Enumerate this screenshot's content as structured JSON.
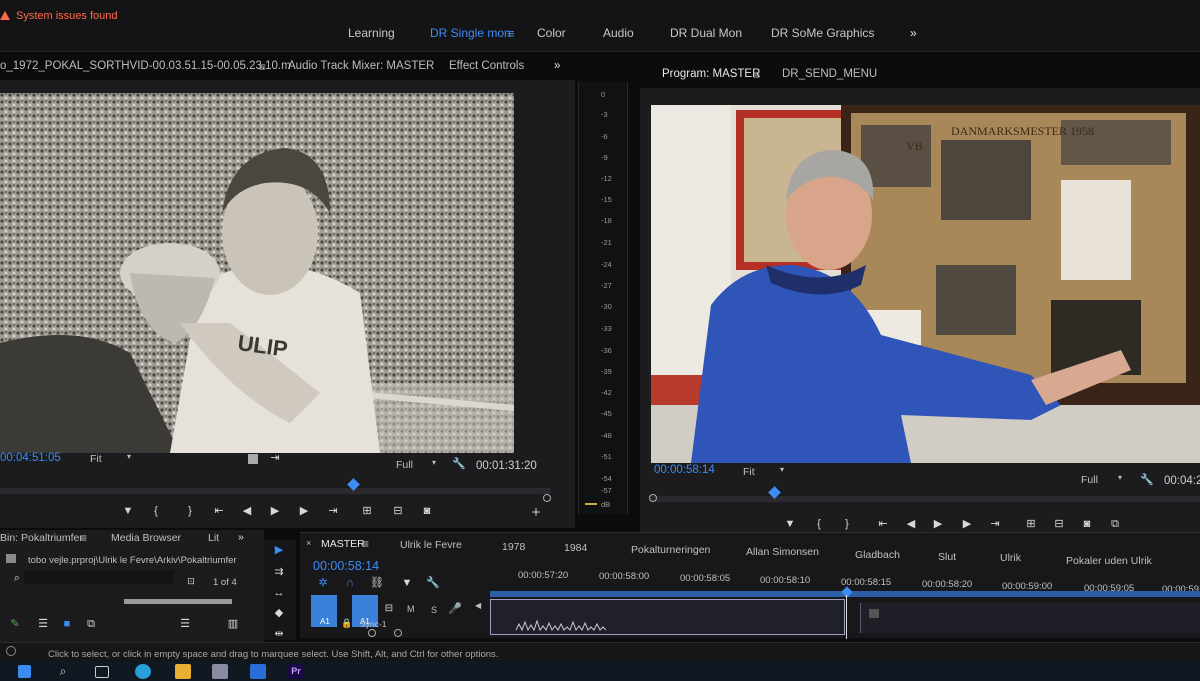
{
  "workspaces": {
    "items": [
      "Learning",
      "DR Single mon",
      "Color",
      "Audio",
      "DR Dual Mon",
      "DR SoMe Graphics"
    ],
    "overflow": "»"
  },
  "error": {
    "text": "System issues found"
  },
  "source_panel": {
    "tabs": [
      "o_1972_POKAL_SORTHVID-00.03.51.15-00.05.23.10.m",
      "Audio Track Mixer: MASTER",
      "Effect Controls"
    ],
    "timecode": "00:04:51:05",
    "fit": "Fit",
    "quality": "Full",
    "duration": "00:01:31:20",
    "jersey_text": "ULIP"
  },
  "program_panel": {
    "tabs": [
      "Program: MASTER",
      "DR_SEND_MENU"
    ],
    "timecode": "00:00:58:14",
    "fit": "Fit",
    "quality": "Full",
    "duration": "00:04:2",
    "poster_title": "DANMARKSMESTER 1958",
    "poster_letters": "VB"
  },
  "meter": {
    "ticks": [
      "0",
      "-3",
      "-6",
      "-9",
      "-12",
      "-15",
      "-18",
      "-21",
      "-24",
      "-27",
      "-30",
      "-33",
      "-36",
      "-39",
      "-42",
      "-45",
      "-48",
      "-51",
      "-54",
      "-57",
      "dB"
    ]
  },
  "project_panel": {
    "tabs": [
      "Bin: Pokaltriumfer",
      "Media Browser",
      "Lit"
    ],
    "path": "tobo vejle.prproj\\Ulrik le Fevre\\Arkiv\\Pokaltriumfer",
    "page": "1 of 4"
  },
  "timeline": {
    "sequence_tabs": [
      "MASTER",
      "Ulrik le Fevre",
      "1978",
      "1984",
      "Pokalturneringen",
      "Allan Simonsen",
      "Gladbach",
      "Slut",
      "Ulrik",
      "Pokaler uden Ulrik"
    ],
    "timecode": "00:00:58:14",
    "ruler": [
      "00:00:57:20",
      "00:00:58:00",
      "00:00:58:05",
      "00:00:58:10",
      "00:00:58:15",
      "00:00:58:20",
      "00:00:59:00",
      "00:00:59:05",
      "00:00:59"
    ],
    "track_labels": [
      "A1",
      "A1"
    ],
    "track_buttons": [
      "M",
      "S"
    ],
    "sync_label": "Sync-1"
  },
  "status": {
    "text": "Click to select, or click in empty space and drag to marquee select. Use Shift, Alt, and Ctrl for other options."
  },
  "taskbar": {
    "premiere_label": "Pr"
  },
  "colors": {
    "accent": "#3c8cf4",
    "error": "#ff6a4a",
    "panel": "#1c1c1e",
    "clip_blue": "#3a7fd8"
  }
}
